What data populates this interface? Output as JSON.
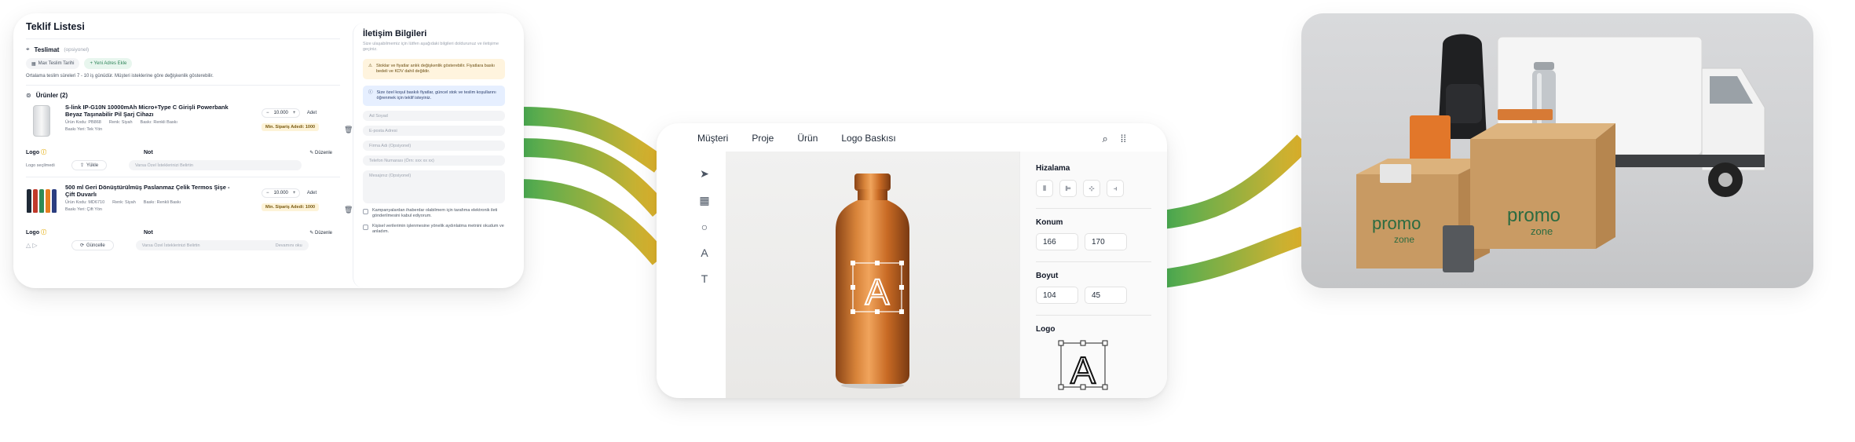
{
  "quote": {
    "title": "Teklif Listesi",
    "delivery_label": "Teslimat",
    "delivery_optional": "(opsiyonel)",
    "max_date_chip": "Max Teslim Tarihi",
    "add_address_chip": "+ Yeni Adres Ekle",
    "delivery_note": "Ortalama teslim süreleri 7 - 10 iş günüdür. Müşteri isteklerine göre değişkenlik gösterebilir.",
    "products_label": "Ürünler (2)",
    "products": [
      {
        "name": "S-link IP-G10N 10000mAh Micro+Type C Girişli Powerbank Beyaz Taşınabilir Pil Şarj Cihazı",
        "code": "Ürün Kodu: PB868",
        "color": "Renk: Siyah",
        "print": "Baskı: Renkli Baskı",
        "print_area": "Baskı Yeri: Tek Yön",
        "qty": "10.000",
        "unit": "Adet",
        "moq": "Min. Sipariş Adedi: 1000",
        "upload_label": "Yükle",
        "note_placeholder": "Varsa Özel İsteklerinizi Belirtin",
        "logo_hint": "Logo seçilmedi",
        "action_label": ""
      },
      {
        "name": "500 ml Geri Dönüştürülmüş Paslanmaz Çelik Termos Şişe - Çift Duvarlı",
        "code": "Ürün Kodu: MD6710",
        "color": "Renk: Siyah",
        "print": "Baskı: Renkli Baskı",
        "print_area": "Baskı Yeri: Çift Yön",
        "qty": "10.000",
        "unit": "Adet",
        "moq": "Min. Sipariş Adedi: 1000",
        "upload_label": "Güncelle",
        "note_placeholder": "Varsa Özel İsteklerinizi Belirtin",
        "logo_hint": "",
        "action_label": "Devamını oku"
      }
    ],
    "logo_label": "Logo",
    "note_label": "Not",
    "edit_label": "Düzenle"
  },
  "contact": {
    "title": "İletişim Bilgileri",
    "subtitle": "Size ulaşabilmemiz için lütfen aşağıdaki bilgileri doldurunuz ve iletişime geçiniz.",
    "warning": "Stoklar ve fiyatlar anlık değişkenlik gösterebilir. Fiyatlara baskı bedeli ve KDV dahil değildir.",
    "info": "Size özel koşul baskılı fiyatlar, güncel stok ve teslim koşullarını öğrenmek için teklif isteyiniz.",
    "fields": [
      "Ad Soyad",
      "E-posta Adresi",
      "Firma Adı (Opsiyonel)",
      "Telefon Numarası (Örn: xxx xx xx)",
      "Mesajınız (Opsiyonel)"
    ],
    "checks": [
      "Kampanyalardan ihaberdar olabilmem için tarafıma elektronik ileti gönderilmesini kabul ediyorum.",
      "Kişisel verilerimin işlenmesine yönelik aydınlatma metnini okudum ve anladım."
    ]
  },
  "editor": {
    "nav": [
      "Müşteri",
      "Proje",
      "Ürün",
      "Logo Baskısı"
    ],
    "tools": [
      "cursor-icon",
      "grid-icon",
      "circle-icon",
      "a-icon",
      "text-icon"
    ],
    "align_label": "Hizalama",
    "position_label": "Konum",
    "position_x": "166",
    "position_y": "170",
    "size_label": "Boyut",
    "size_w": "104",
    "size_h": "45",
    "logo_label": "Logo"
  },
  "photo": {
    "brand": "promozone"
  },
  "colors": {
    "ribbon_green": "#4cae54",
    "ribbon_yellow": "#e0b52a",
    "bottle_orange": "#c9722b",
    "accent_green": "#2f855a"
  }
}
